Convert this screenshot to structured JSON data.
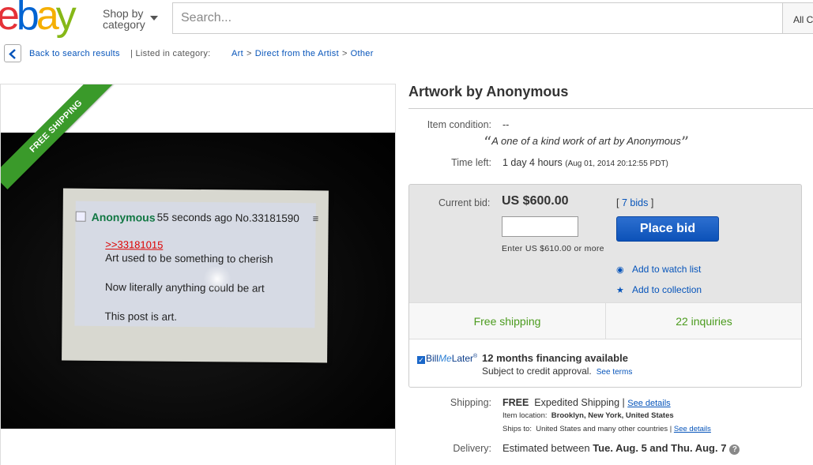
{
  "header": {
    "logo": [
      "e",
      "b",
      "a",
      "y"
    ],
    "shop_by_line1": "Shop by",
    "shop_by_line2": "category",
    "search_placeholder": "Search...",
    "category_select": "All C"
  },
  "breadcrumb": {
    "back": "Back to search results",
    "listed": "| Listed in category:",
    "path": [
      "Art",
      "Direct from the Artist",
      "Other"
    ],
    "separator": ">"
  },
  "image": {
    "ribbon": "FREE SHIPPING",
    "post": {
      "name": "Anonymous",
      "meta": "55 seconds ago No.33181590",
      "menu": "≡",
      "link": ">>33181015",
      "lines": [
        "Art used to be something to cherish",
        "Now literally anything could be art",
        "This post is art."
      ]
    }
  },
  "item": {
    "title": "Artwork by Anonymous",
    "condition_label": "Item condition:",
    "condition_value": "--",
    "quote_open": "“",
    "quote": "A one of a kind work of art by Anonymous",
    "quote_close": "”",
    "time_left_label": "Time left:",
    "time_left_value": "1 day 4 hours",
    "time_left_detail": "(Aug 01, 2014  20:12:55 PDT)"
  },
  "bid": {
    "label": "Current bid:",
    "price": "US $600.00",
    "bids_open": "[",
    "bids_link": "7 bids",
    "bids_close": "]",
    "input_value": "",
    "button": "Place bid",
    "hint": "Enter US $610.00 or more",
    "watch": "Add to watch list",
    "collection": "Add to collection",
    "shipping_badge": "Free shipping",
    "inquiries": "22 inquiries"
  },
  "finance": {
    "brand_check": "✓",
    "brand_a": "Bill",
    "brand_b": "Me",
    "brand_c": "Later",
    "brand_reg": "®",
    "title": "12 months financing available",
    "sub": "Subject to credit approval.",
    "link": "See terms"
  },
  "shipping": {
    "label": "Shipping:",
    "free": "FREE",
    "method": "Expedited Shipping |",
    "details_link": "See details",
    "location_label": "Item location:",
    "location": "Brooklyn, New York, United States",
    "ships_to_label": "Ships to:",
    "ships_to": "United States and many other countries |",
    "ships_to_link": "See details"
  },
  "delivery": {
    "label": "Delivery:",
    "text": "Estimated between",
    "dates": "Tue. Aug. 5 and Thu. Aug. 7",
    "help": "?"
  },
  "colors": {
    "link": "#0654ba",
    "green": "#4b9b1e",
    "button": "#0c52b8"
  }
}
